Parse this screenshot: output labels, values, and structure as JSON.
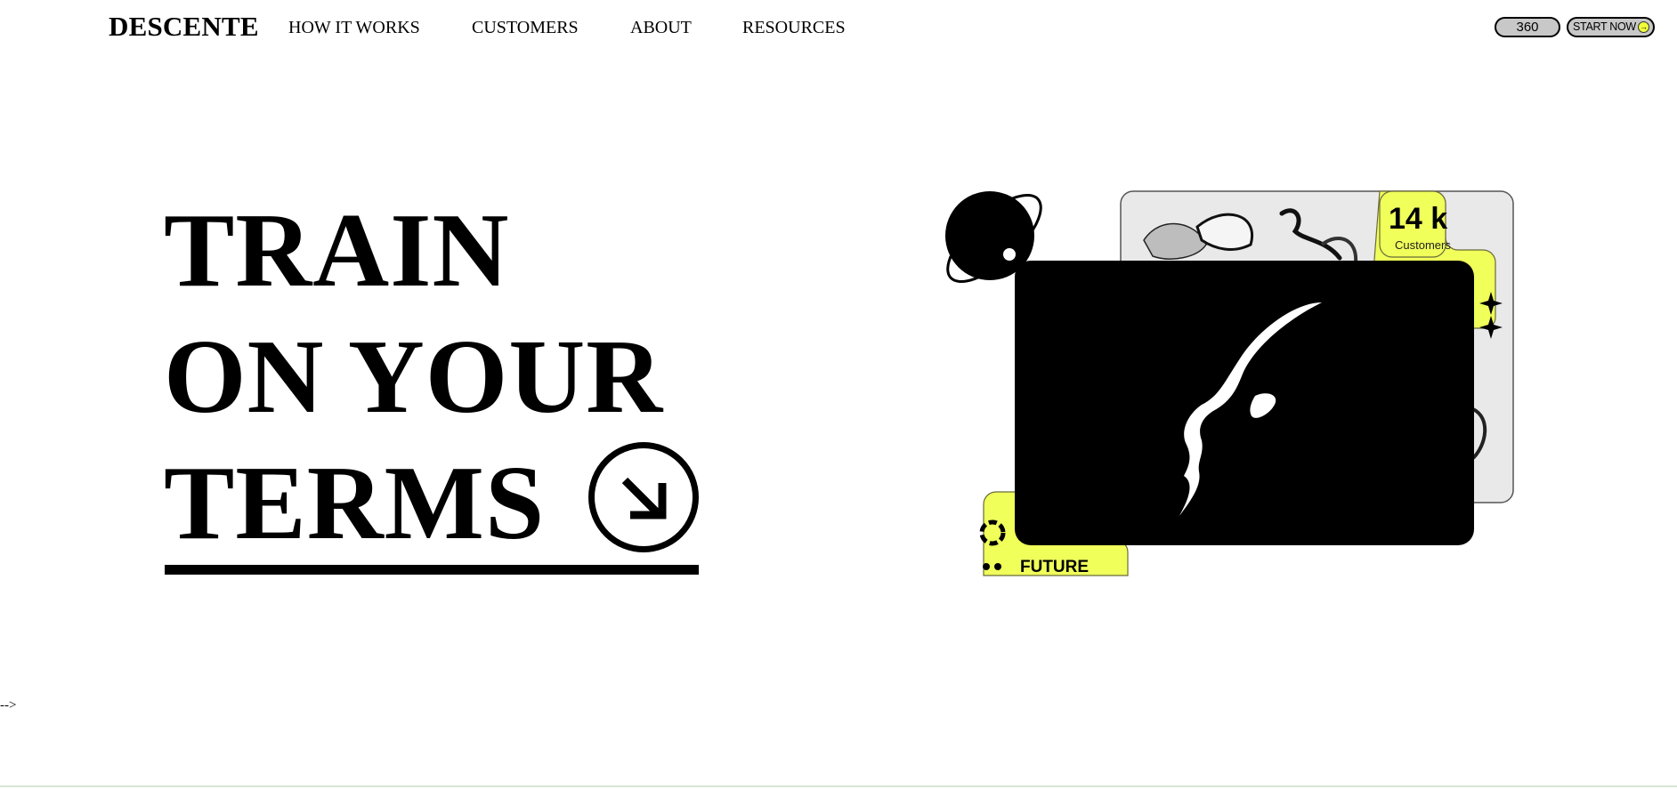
{
  "header": {
    "logo": "DESCENTE",
    "nav": [
      "HOW IT WORKS",
      "CUSTOMERS",
      "ABOUT",
      "RESOURCES"
    ],
    "pill_360": "360",
    "start_now": "START NOW"
  },
  "hero": {
    "line1": "TRAIN",
    "line2": "ON YOUR",
    "line3": "TERMS",
    "stat_value": "14 k",
    "stat_label": "Customers",
    "future_label": "FUTURE"
  },
  "footer": {
    "comment_residue": "-->"
  },
  "colors": {
    "accent": "#f0ff5a",
    "dark": "#000000",
    "panel": "#e9e9e9"
  },
  "icons": [
    "arrow-down-right-icon",
    "sparkle-icon",
    "orbit-planet-icon",
    "ring-icon",
    "dots-icon"
  ]
}
